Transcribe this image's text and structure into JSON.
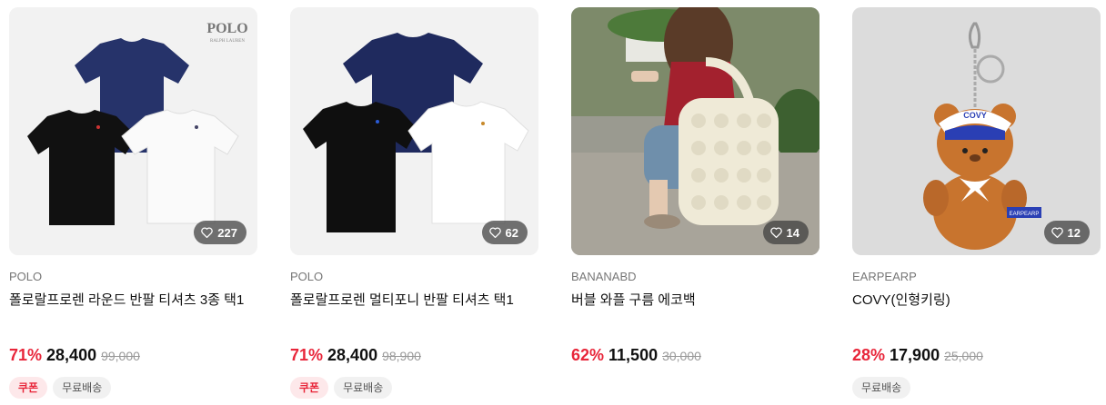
{
  "products": [
    {
      "brand": "POLO",
      "name": "폴로랄프로렌 라운드 반팔 티셔츠 3종 택1",
      "likes": "227",
      "discount": "71%",
      "price": "28,400",
      "original_price": "99,000",
      "image_logo": "POLO",
      "image_logo_sub": "RALPH LAUREN",
      "tags": [
        "쿠폰",
        "무료배송"
      ]
    },
    {
      "brand": "POLO",
      "name": "폴로랄프로렌 멀티포니 반팔 티셔츠 택1",
      "likes": "62",
      "discount": "71%",
      "price": "28,400",
      "original_price": "98,900",
      "tags": [
        "쿠폰",
        "무료배송"
      ]
    },
    {
      "brand": "BANANABD",
      "name": "버블 와플 구름 에코백",
      "likes": "14",
      "discount": "62%",
      "price": "11,500",
      "original_price": "30,000",
      "tags": []
    },
    {
      "brand": "EARPEARP",
      "name": "COVY(인형키링)",
      "likes": "12",
      "discount": "28%",
      "price": "17,900",
      "original_price": "25,000",
      "image_hat_text": "COVY",
      "image_tag_text": "EARPEARP",
      "tags": [
        "무료배송"
      ]
    }
  ],
  "colors": {
    "discount": "#e8263a",
    "navy": "#26336a",
    "bear": "#c8742e"
  }
}
